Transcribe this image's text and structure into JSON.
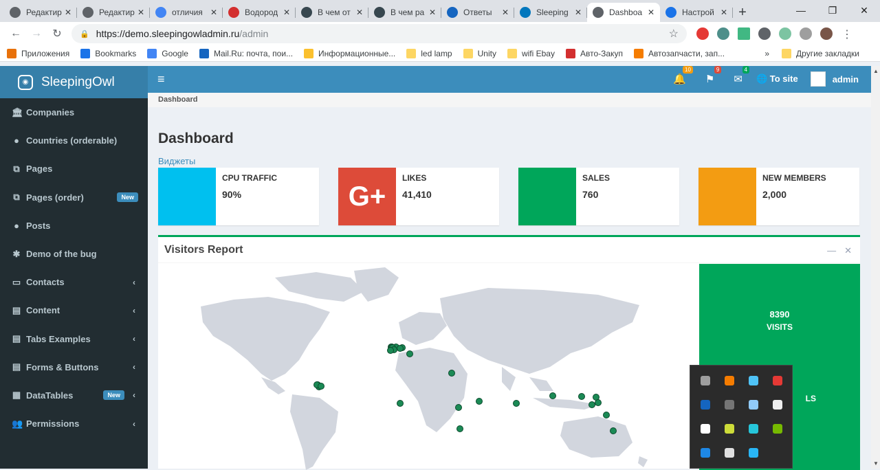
{
  "browser": {
    "tabs": [
      {
        "title": "Редактир",
        "fav_color": "#5f6368",
        "active": false
      },
      {
        "title": "Редактир",
        "fav_color": "#5f6368",
        "active": false
      },
      {
        "title": "отличия",
        "fav_color": "#4285f4",
        "active": false
      },
      {
        "title": "Водород",
        "fav_color": "#d32f2f",
        "active": false
      },
      {
        "title": "В чем от",
        "fav_color": "#37474f",
        "active": false
      },
      {
        "title": "В чем ра",
        "fav_color": "#37474f",
        "active": false
      },
      {
        "title": "Ответы",
        "fav_color": "#1565c0",
        "active": false
      },
      {
        "title": "Sleeping",
        "fav_color": "#0277bd",
        "active": false
      },
      {
        "title": "Dashboa",
        "fav_color": "#5f6368",
        "active": true
      },
      {
        "title": "Настрой",
        "fav_color": "#1a73e8",
        "active": false
      }
    ],
    "url_host": "https://demo.sleepingowladmin.ru",
    "url_path": "/admin",
    "bookmarks": [
      {
        "label": "Приложения",
        "color": "#e8710a"
      },
      {
        "label": "Bookmarks",
        "color": "#1a73e8"
      },
      {
        "label": "Google",
        "color": "#4285f4"
      },
      {
        "label": "Mail.Ru: почта, пои...",
        "color": "#1565c0"
      },
      {
        "label": "Информационные...",
        "color": "#fbc02d"
      },
      {
        "label": "led lamp",
        "color": "#fdd663"
      },
      {
        "label": "Unity",
        "color": "#fdd663"
      },
      {
        "label": "wifi Ebay",
        "color": "#fdd663"
      },
      {
        "label": "Авто-Закуп",
        "color": "#d32f2f"
      },
      {
        "label": "Автозапчасти, зап...",
        "color": "#f57c00"
      }
    ],
    "other_bookmarks": "Другие закладки",
    "more": "»"
  },
  "app": {
    "brand": "SleepingOwl",
    "menu": [
      {
        "label": "Companies",
        "icon": "🏛",
        "chevron": false,
        "badge": ""
      },
      {
        "label": "Countries (orderable)",
        "icon": "●",
        "chevron": false,
        "badge": ""
      },
      {
        "label": "Pages",
        "icon": "⧉",
        "chevron": false,
        "badge": ""
      },
      {
        "label": "Pages (order)",
        "icon": "⧉",
        "chevron": false,
        "badge": "New"
      },
      {
        "label": "Posts",
        "icon": "●",
        "chevron": false,
        "badge": ""
      },
      {
        "label": "Demo of the bug",
        "icon": "✱",
        "chevron": false,
        "badge": ""
      },
      {
        "label": "Contacts",
        "icon": "▭",
        "chevron": true,
        "badge": ""
      },
      {
        "label": "Content",
        "icon": "▤",
        "chevron": true,
        "badge": ""
      },
      {
        "label": "Tabs Examples",
        "icon": "▤",
        "chevron": true,
        "badge": ""
      },
      {
        "label": "Forms & Buttons",
        "icon": "▤",
        "chevron": true,
        "badge": ""
      },
      {
        "label": "DataTables",
        "icon": "▦",
        "chevron": true,
        "badge": "New"
      },
      {
        "label": "Permissions",
        "icon": "👥",
        "chevron": true,
        "badge": ""
      }
    ],
    "nav": {
      "bell_count": "10",
      "flag_count": "9",
      "mail_count": "4",
      "to_site": "To site",
      "user": "admin"
    },
    "breadcrumb": "Dashboard",
    "page_title": "Dashboard",
    "widgets_link": "Виджеты",
    "info_boxes": [
      {
        "text": "CPU TRAFFIC",
        "number": "90%",
        "color": "#00c0ef",
        "icon": ""
      },
      {
        "text": "LIKES",
        "number": "41,410",
        "color": "#dd4b39",
        "icon": "G+"
      },
      {
        "text": "SALES",
        "number": "760",
        "color": "#00a65a",
        "icon": ""
      },
      {
        "text": "NEW MEMBERS",
        "number": "2,000",
        "color": "#f39c12",
        "icon": ""
      }
    ],
    "visitors": {
      "title": "Visitors Report",
      "visits_number": "8390",
      "visits_label": "VISITS",
      "partial_label": "LS"
    }
  }
}
